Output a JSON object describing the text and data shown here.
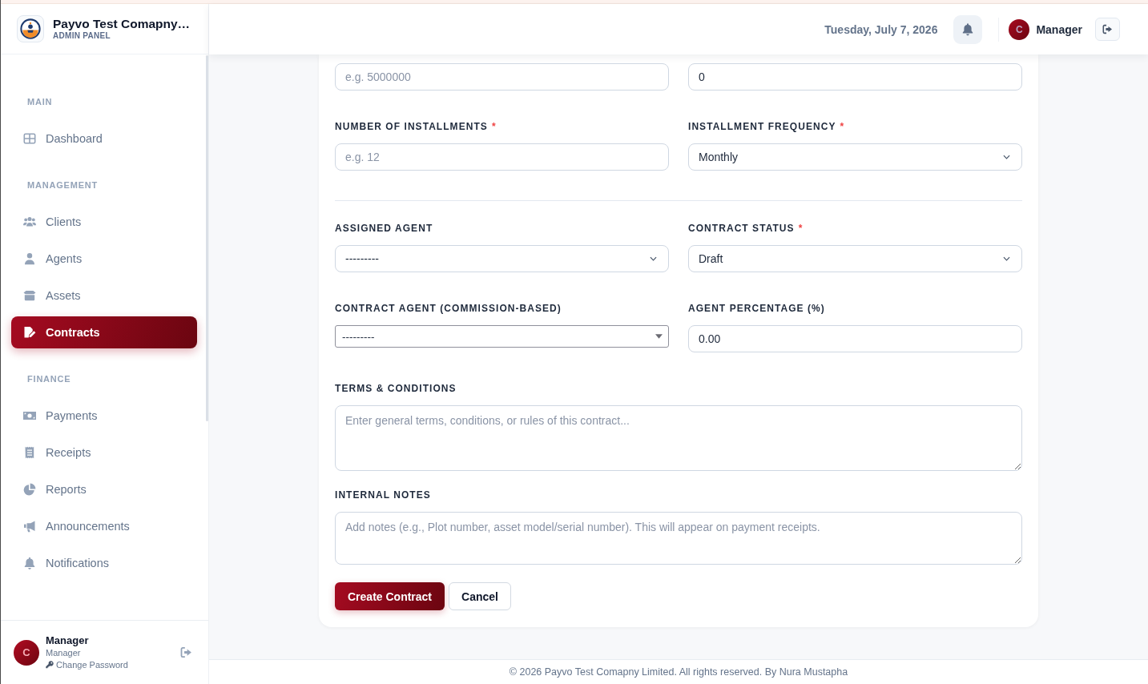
{
  "sidebar": {
    "brand": {
      "title": "Payvo Test Comapny…",
      "subtitle": "ADMIN PANEL"
    },
    "sections": [
      {
        "heading": "MAIN",
        "items": [
          {
            "label": "Dashboard",
            "selected": false
          }
        ]
      },
      {
        "heading": "MANAGEMENT",
        "items": [
          {
            "label": "Clients",
            "selected": false
          },
          {
            "label": "Agents",
            "selected": false
          },
          {
            "label": "Assets",
            "selected": false
          },
          {
            "label": "Contracts",
            "selected": true
          }
        ]
      },
      {
        "heading": "FINANCE",
        "items": [
          {
            "label": "Payments",
            "selected": false
          },
          {
            "label": "Receipts",
            "selected": false
          },
          {
            "label": "Reports",
            "selected": false
          },
          {
            "label": "Announcements",
            "selected": false
          },
          {
            "label": "Notifications",
            "selected": false
          }
        ]
      }
    ],
    "user": {
      "initial": "C",
      "name": "Manager",
      "role": "Manager",
      "link": "Change Password"
    }
  },
  "header": {
    "date": "Tuesday, July 7, 2026",
    "user": {
      "initial": "C",
      "name": "Manager"
    }
  },
  "form": {
    "sections": [
      {
        "rows": [
          [
            {
              "kind": "input",
              "placeholder": "e.g. 5000000"
            },
            {
              "kind": "input",
              "value": "0"
            }
          ],
          [
            {
              "kind": "input",
              "label": "NUMBER OF INSTALLMENTS",
              "marker": "*",
              "placeholder": "e.g. 12"
            },
            {
              "kind": "select",
              "label": "INSTALLMENT FREQUENCY",
              "marker": "*",
              "value": "Monthly"
            }
          ]
        ]
      },
      {
        "rows": [
          [
            {
              "kind": "select",
              "label": "ASSIGNED AGENT",
              "value": "---------"
            },
            {
              "kind": "select",
              "label": "CONTRACT STATUS",
              "marker": "*",
              "value": "Draft"
            }
          ],
          [
            {
              "kind": "native-select",
              "label": "CONTRACT AGENT (COMMISSION-BASED)",
              "value": "---------"
            },
            {
              "kind": "input",
              "label": "AGENT PERCENTAGE (%)",
              "value": "0.00"
            }
          ],
          [
            {
              "kind": "textarea",
              "label": "TERMS & CONDITIONS",
              "placeholder": "Enter general terms, conditions, or rules of this contract..."
            }
          ],
          [
            {
              "kind": "textarea",
              "label": "INTERNAL NOTES",
              "placeholder": "Add notes (e.g., Plot number, asset model/serial number). This will appear on payment receipts."
            }
          ]
        ]
      }
    ],
    "buttons": [
      {
        "kind": "primary",
        "label": "Create Contract"
      },
      {
        "kind": "secondary",
        "label": "Cancel"
      }
    ]
  },
  "footer": {
    "text": "© 2026 Payvo Test Comapny Limited. All rights reserved. By Nura Mustapha"
  }
}
